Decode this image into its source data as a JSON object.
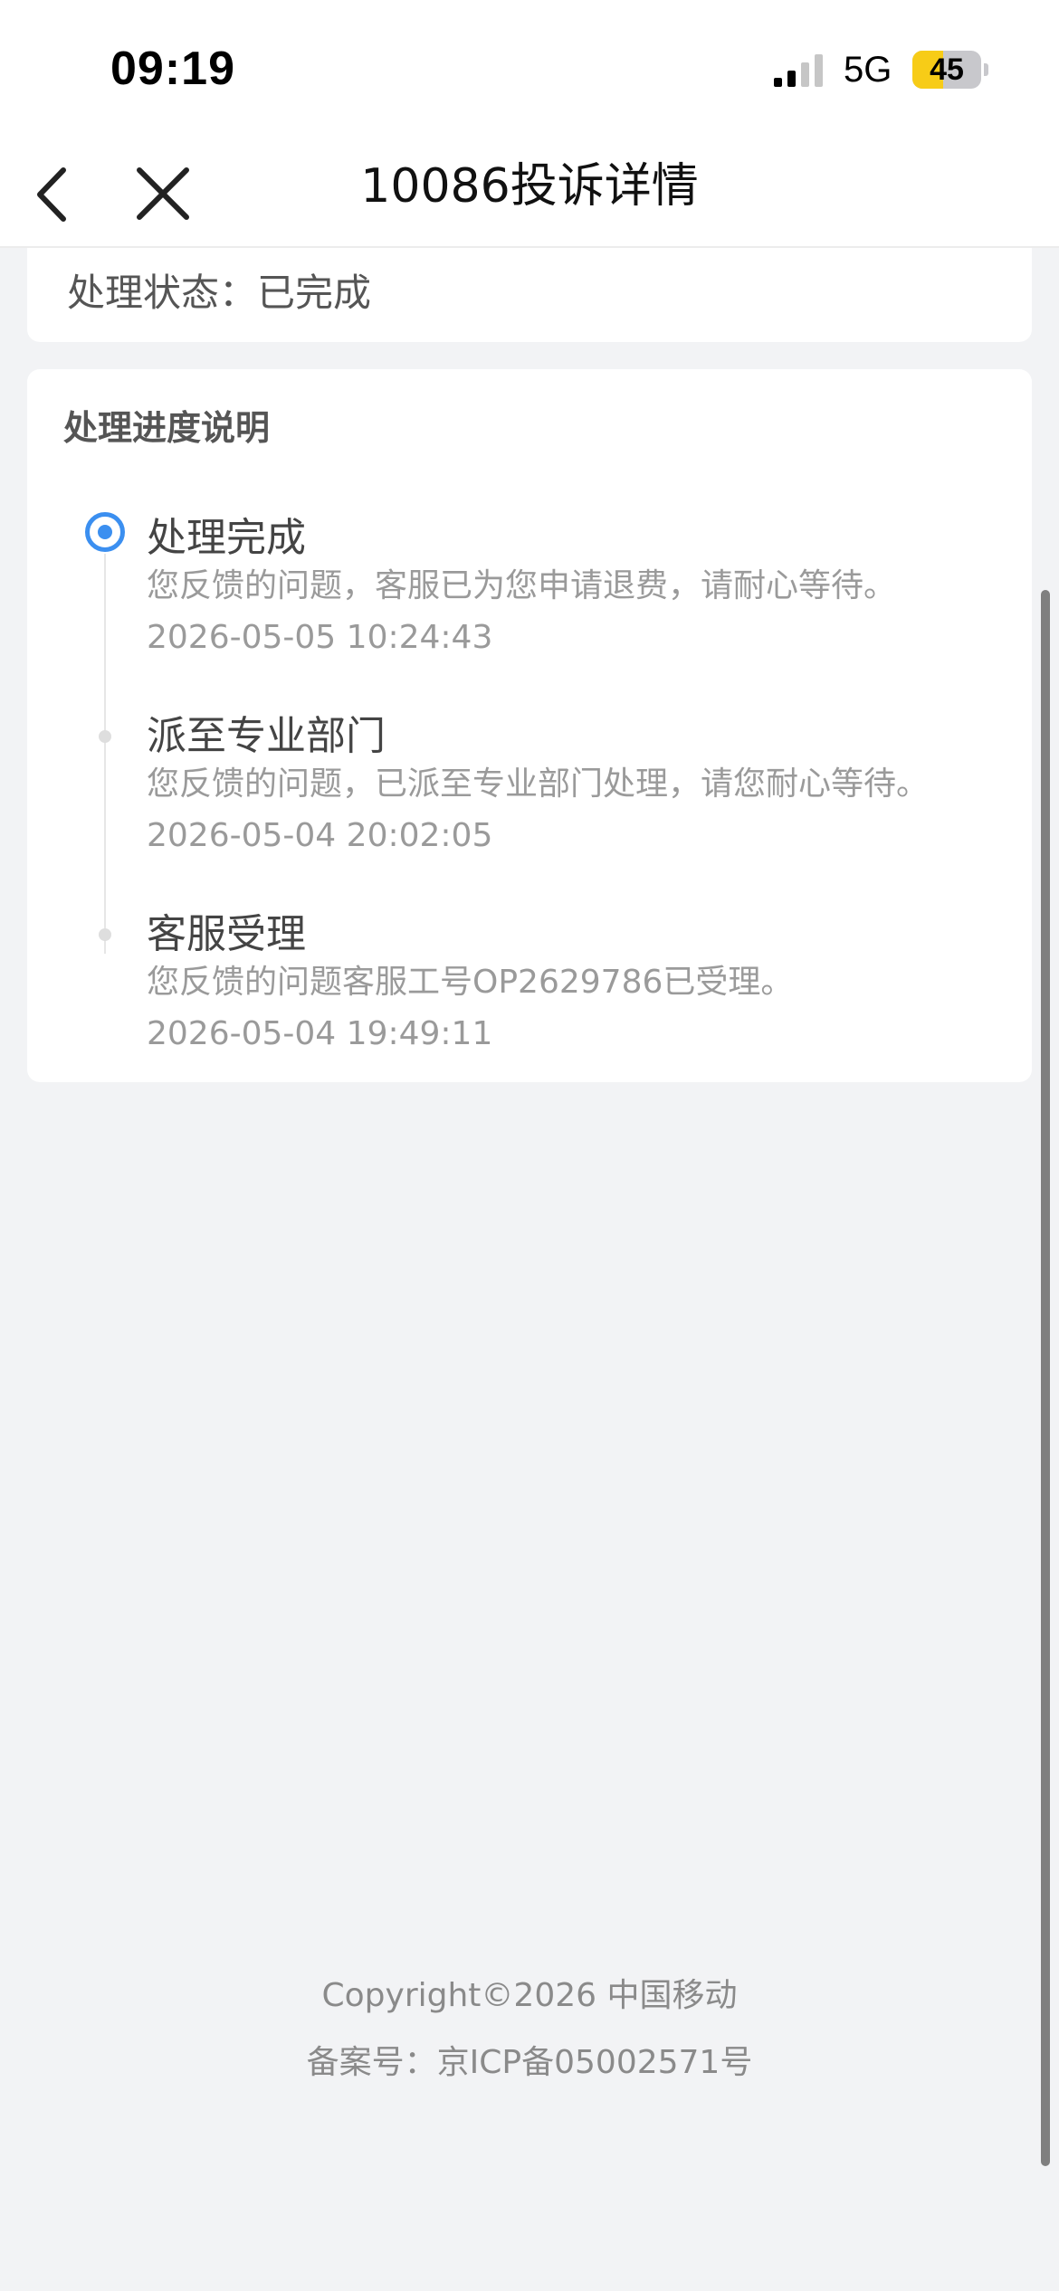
{
  "status_bar": {
    "time": "09:19",
    "network": "5G",
    "battery": "45",
    "battery_level": 0.45,
    "signal_icon": "signal-bars-icon"
  },
  "nav": {
    "title": "10086投诉详情",
    "back_icon": "chevron-left-icon",
    "close_icon": "close-icon"
  },
  "status_card": {
    "label": "处理状态：已完成"
  },
  "progress": {
    "title": "处理进度说明",
    "steps": [
      {
        "title": "处理完成",
        "desc": "您反馈的问题，客服已为您申请退费，请耐心等待。",
        "time": "2026-05-05 10:24:43"
      },
      {
        "title": "派至专业部门",
        "desc": "您反馈的问题，已派至专业部门处理，请您耐心等待。",
        "time": "2026-05-04 20:02:05"
      },
      {
        "title": "客服受理",
        "desc": "您反馈的问题客服工号OP2629786已受理。",
        "time": "2026-05-04 19:49:11"
      }
    ]
  },
  "footer": {
    "copyright": "Copyright©2026 中国移动",
    "icp": "备案号：京ICP备05002571号"
  },
  "colors": {
    "accent": "#3b8ff0",
    "battery_fill": "#f7cc17",
    "background": "#f2f3f5"
  }
}
